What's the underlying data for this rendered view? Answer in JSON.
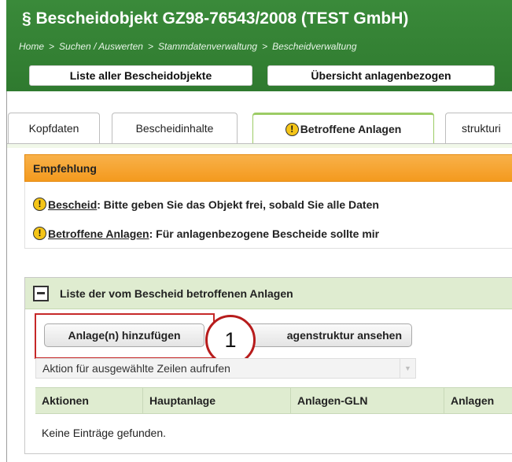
{
  "header": {
    "title": "§ Bescheidobjekt GZ98-76543/2008 (TEST GmbH)",
    "breadcrumb": [
      "Home",
      "Suchen / Auswerten",
      "Stammdatenverwaltung",
      "Bescheidverwaltung"
    ],
    "breadcrumb_separator": ">",
    "buttons": {
      "list_all": "Liste aller Bescheidobjekte",
      "overview": "Übersicht anlagenbezogen"
    }
  },
  "tabs": [
    {
      "label": "Kopfdaten",
      "active": false
    },
    {
      "label": "Bescheidinhalte",
      "active": false
    },
    {
      "label": "Betroffene Anlagen",
      "active": true,
      "icon": "warning-icon"
    },
    {
      "label": "strukturi",
      "active": false
    }
  ],
  "recommendation": {
    "heading": "Empfehlung",
    "lines": [
      {
        "link": "Bescheid",
        "text": ": Bitte geben Sie das Objekt frei, sobald Sie alle Daten"
      },
      {
        "link": "Betroffene Anlagen",
        "text": ": Für anlagenbezogene Bescheide sollte mir"
      }
    ]
  },
  "list": {
    "heading": "Liste der vom Bescheid betroffenen Anlagen",
    "add_button": "Anlage(n) hinzufügen",
    "structure_button": "agenstruktur ansehen",
    "action_select": "Aktion für ausgewählte Zeilen aufrufen",
    "columns": [
      "Aktionen",
      "Hauptanlage",
      "Anlagen-GLN",
      "Anlagen"
    ],
    "empty_message": "Keine Einträge gefunden."
  },
  "callout": {
    "number": "1"
  },
  "colors": {
    "header_green": "#2f7a2f",
    "recommendation_orange": "#f49a1e",
    "panel_green": "#dfecd0",
    "callout_red": "#b71c1c"
  }
}
